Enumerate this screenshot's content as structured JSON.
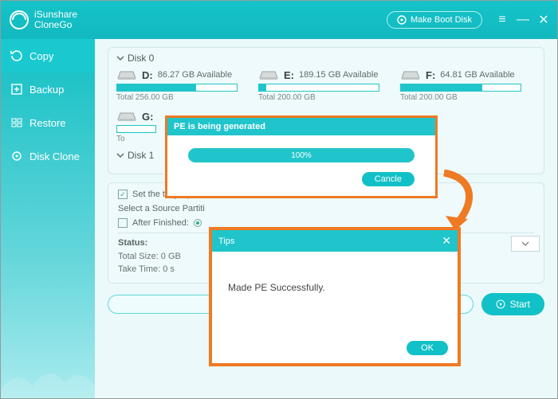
{
  "app": {
    "name_line1": "iSunshare",
    "name_line2": "CloneGo"
  },
  "titlebar": {
    "make_boot": "Make Boot Disk"
  },
  "sidebar": {
    "items": [
      {
        "label": "Copy"
      },
      {
        "label": "Backup"
      },
      {
        "label": "Restore"
      },
      {
        "label": "Disk Clone"
      }
    ]
  },
  "disks": {
    "d0": {
      "head": "Disk 0",
      "vols": [
        {
          "letter": "D:",
          "avail": "86.27 GB Available",
          "total": "Total 256.00 GB",
          "fill": 66
        },
        {
          "letter": "E:",
          "avail": "189.15 GB Available",
          "total": "Total 200.00 GB",
          "fill": 6
        },
        {
          "letter": "F:",
          "avail": "64.81 GB Available",
          "total": "Total 200.00 GB",
          "fill": 68
        }
      ],
      "g": {
        "letter": "G:",
        "total_prefix": "To"
      }
    },
    "d1": {
      "head": "Disk 1"
    }
  },
  "options": {
    "set_target": "Set the target partition as the boot disk?",
    "select_src": "Select a Source Partiti",
    "after_finished": "After Finished:",
    "status_label": "Status:",
    "total_size": "Total Size: 0 GB",
    "take_time": "Take Time: 0 s"
  },
  "footer": {
    "start": "Start"
  },
  "progress_dialog": {
    "title": "PE is being generated",
    "percent": "100%",
    "cancel": "Cancle"
  },
  "tips_dialog": {
    "title": "Tips",
    "message": "Made PE Successfully.",
    "ok": "OK"
  },
  "colors": {
    "accent": "#20c5cb",
    "highlight": "#ee7a23"
  }
}
